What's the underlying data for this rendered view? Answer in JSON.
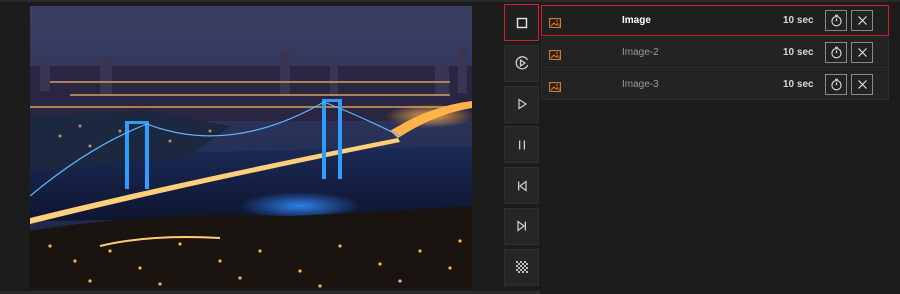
{
  "preview": {
    "alt_subject": "night-city-bridge-image"
  },
  "controls": [
    {
      "name": "stop-button",
      "icon": "square-icon",
      "active": true
    },
    {
      "name": "play-timed-button",
      "icon": "play-circle-icon",
      "active": false
    },
    {
      "name": "play-button",
      "icon": "play-icon",
      "active": false
    },
    {
      "name": "pause-button",
      "icon": "pause-icon",
      "active": false
    },
    {
      "name": "previous-button",
      "icon": "skip-back-icon",
      "active": false
    },
    {
      "name": "next-button",
      "icon": "skip-forward-icon",
      "active": false
    },
    {
      "name": "pattern-button",
      "icon": "checker-icon",
      "active": false
    }
  ],
  "playlist": {
    "items": [
      {
        "name": "Image",
        "duration": "10 sec",
        "selected": true
      },
      {
        "name": "Image-2",
        "duration": "10 sec",
        "selected": false
      },
      {
        "name": "Image-3",
        "duration": "10 sec",
        "selected": false
      }
    ]
  },
  "colors": {
    "accent": "#d0212a",
    "thumb_icon": "#e07a2a",
    "background": "#1c1c1c"
  }
}
